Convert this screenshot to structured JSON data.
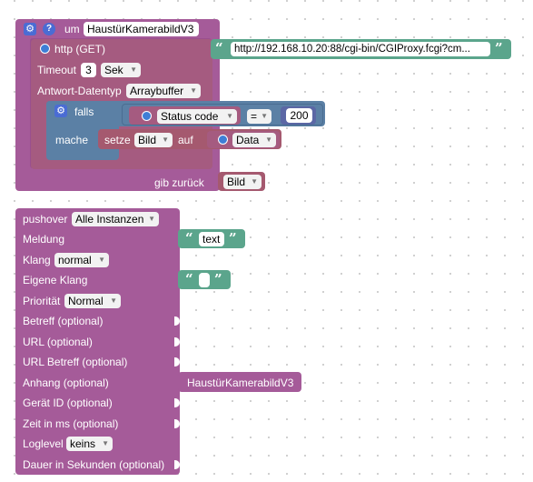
{
  "function_block": {
    "name_prefix": "um",
    "name": "HaustürKamerabildV3",
    "http_label": "http (GET)",
    "url": "http://192.168.10.20:88/cgi-bin/CGIProxy.fcgi?cm...",
    "timeout_label": "Timeout",
    "timeout_value": "3",
    "timeout_unit": "Sek",
    "response_type_label": "Antwort-Datentyp",
    "response_type_value": "Arraybuffer",
    "if_label": "falls",
    "status_code": "Status code",
    "operator": "=",
    "compare_value": "200",
    "do_label": "mache",
    "set_label": "setze",
    "set_var": "Bild",
    "set_to": "auf",
    "data_label": "Data",
    "return_label": "gib zurück",
    "return_var": "Bild"
  },
  "pushover_block": {
    "title": "pushover",
    "instance": "Alle Instanzen",
    "message_label": "Meldung",
    "message_value": "text",
    "sound_label": "Klang",
    "sound_value": "normal",
    "custom_sound_label": "Eigene Klang",
    "priority_label": "Priorität",
    "priority_value": "Normal",
    "subject_label": "Betreff (optional)",
    "url_label": "URL (optional)",
    "url_subject_label": "URL Betreff (optional)",
    "attachment_label": "Anhang (optional)",
    "attachment_value": "HaustürKamerabildV3",
    "device_label": "Gerät ID (optional)",
    "time_label": "Zeit in ms (optional)",
    "loglevel_label": "Loglevel",
    "loglevel_value": "keins",
    "duration_label": "Dauer in Sekunden (optional)"
  },
  "colors": {
    "procedure": "#a55b99",
    "http": "#a55b80",
    "if_block": "#5b80a5",
    "variable": "#a5596f",
    "text": "#5ba58c",
    "pushover": "#a55b99"
  },
  "icons": [
    "gear-icon",
    "help-icon",
    "globe-icon",
    "quote-icon",
    "dropdown-arrow-icon"
  ]
}
